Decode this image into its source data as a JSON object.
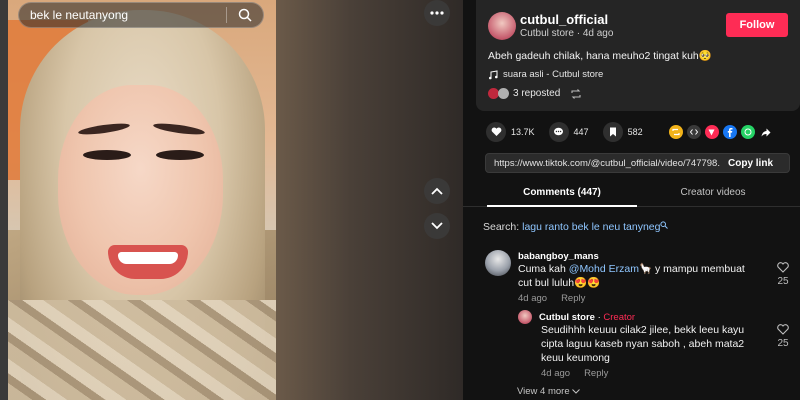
{
  "search": {
    "query": "bek le neutanyong"
  },
  "author": {
    "username": "cutbul_official",
    "display_name": "Cutbul store",
    "time_ago": "4d ago",
    "follow_label": "Follow",
    "caption": "Abeh gadeuh chilak, hana meuho2 tingat kuh🥺",
    "music": "suara asli - Cutbul store",
    "reposted": "3 reposted"
  },
  "stats": {
    "likes": "13.7K",
    "comments": "447",
    "saves": "582"
  },
  "link": {
    "url": "https://www.tiktok.com/@cutbul_official/video/747798...",
    "copy_label": "Copy link"
  },
  "tabs": {
    "comments": "Comments (447)",
    "creator_videos": "Creator videos"
  },
  "comment_search": {
    "prefix": "Search: ",
    "query": "lagu ranto bek le neu tanyneg"
  },
  "comments": [
    {
      "name": "babangboy_mans",
      "before_mention": "Cuma kah ",
      "mention": "@Mohd Erzam",
      "after_mention": "🦙 y mampu membuat",
      "line2": "cut bul luluh😍😍",
      "time": "4d ago",
      "reply_label": "Reply",
      "likes": "25"
    },
    {
      "name": "Cutbul store",
      "separator": " · ",
      "creator_label": "Creator",
      "line1": "Seudihhh keuuu cilak2 jilee, bekk leeu kayu",
      "line2": "cipta laguu kaseb nyan saboh , abeh mata2",
      "line3": "keuu keumong",
      "time": "4d ago",
      "reply_label": "Reply",
      "likes": "25"
    }
  ],
  "view_more": "View 4 more",
  "colors": {
    "accent": "#fe2c55",
    "mention": "#8fc6ff",
    "panel": "#252525"
  }
}
